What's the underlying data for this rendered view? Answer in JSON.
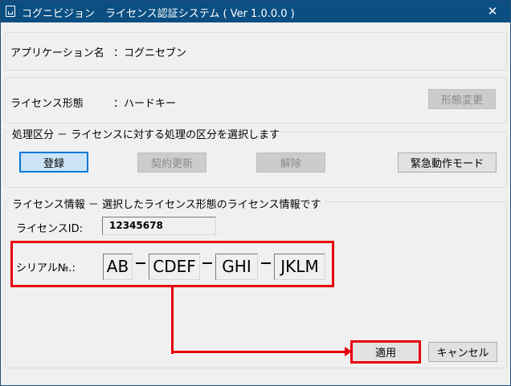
{
  "window": {
    "title": "コグニビジョン　ライセンス認証システム ( Ver 1.0.0.0 )",
    "close_glyph": "✕"
  },
  "application": {
    "label": "アプリケーション名",
    "value": "：コグニセブン"
  },
  "license_type": {
    "label": "ライセンス形態",
    "value": "：ハードキー",
    "change_button": "形態変更"
  },
  "processing": {
    "group_title": "処理区分 － ライセンスに対する処理の区分を選択します",
    "buttons": {
      "register": "登録",
      "renew": "契約更新",
      "release": "解除",
      "emergency": "緊急動作モード"
    }
  },
  "license_info": {
    "group_title": "ライセンス情報 － 選択したライセンス形態のライセンス情報です",
    "id_label": "ライセンスID:",
    "id_value": "12345678",
    "serial_label": "シリアル№.:",
    "serial_parts": [
      "AB",
      "CDEF",
      "GHI",
      "JKLM"
    ]
  },
  "footer": {
    "apply_button": "適用",
    "cancel_button": "キャンセル"
  },
  "colors": {
    "titlebar": "#0b4f82",
    "highlight": "#e8000e",
    "primary_button": "#cce4f7"
  }
}
